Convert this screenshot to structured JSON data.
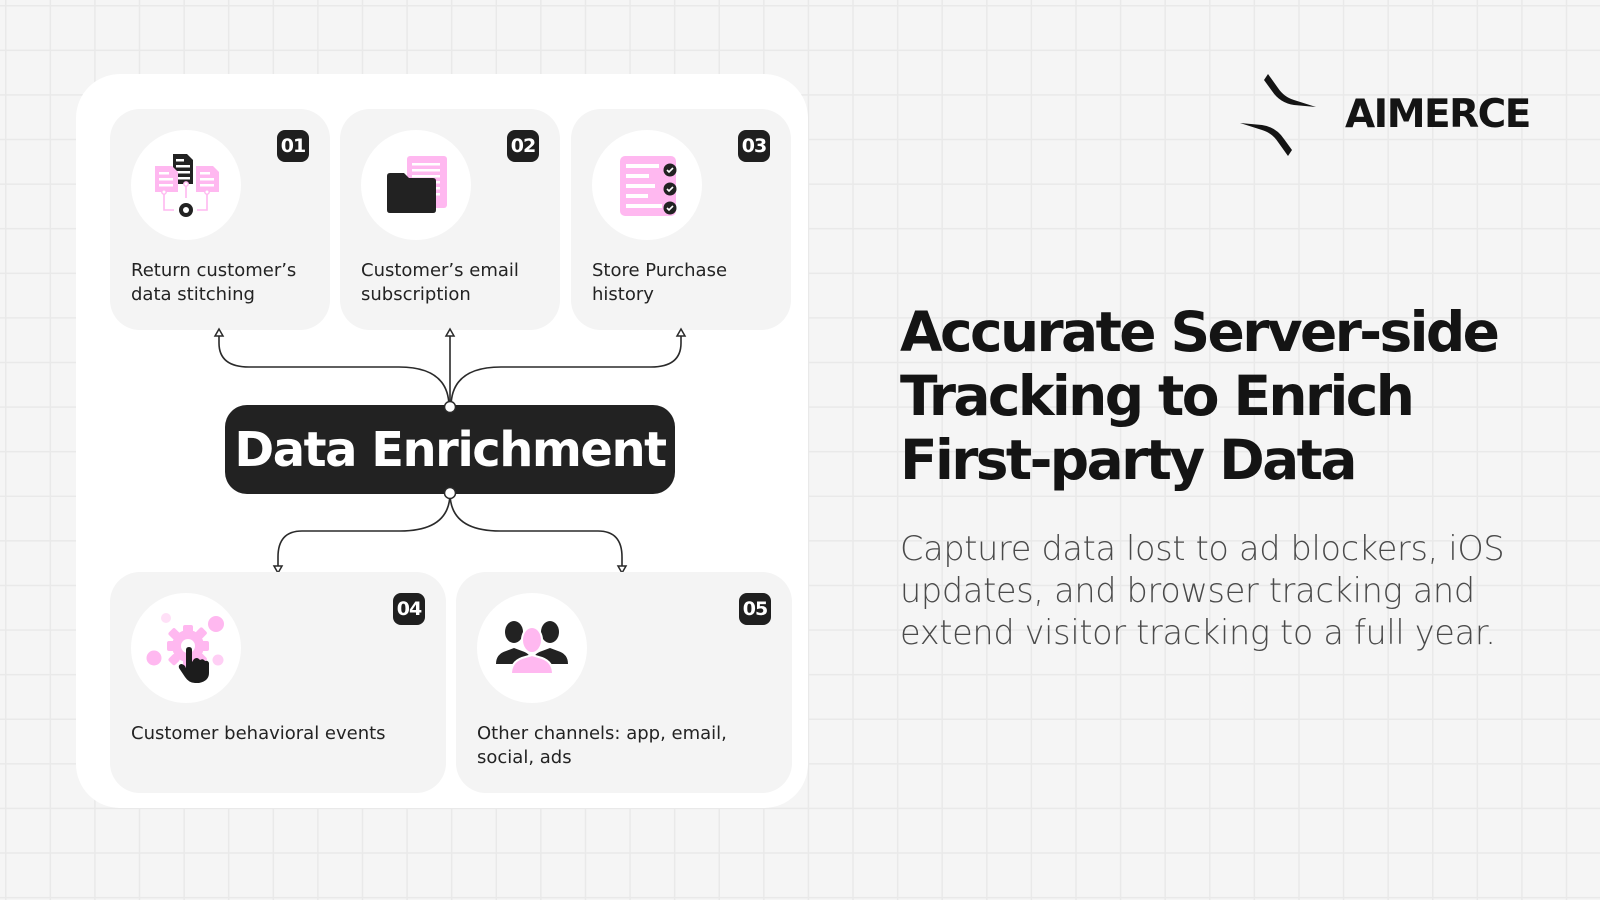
{
  "brand": {
    "name": "AIMERCE",
    "logo_icon": "aimerce-logo-icon"
  },
  "colors": {
    "accent_pink": "#ffb8f0",
    "dark": "#222222",
    "card_bg": "#f4f4f4",
    "panel_bg": "#ffffff",
    "page_bg": "#f5f5f5"
  },
  "diagram": {
    "hub_label": "Data Enrichment",
    "top_cards": [
      {
        "number": "01",
        "label": "Return customer’s data stitching",
        "icon": "data-stitching-icon"
      },
      {
        "number": "02",
        "label": "Customer’s email subscription",
        "icon": "email-folder-icon"
      },
      {
        "number": "03",
        "label": "Store Purchase history",
        "icon": "purchase-checklist-icon"
      }
    ],
    "bottom_cards": [
      {
        "number": "04",
        "label": "Customer behavioral events",
        "icon": "gear-click-icon"
      },
      {
        "number": "05",
        "label": "Other channels: app, email, social, ads",
        "icon": "users-group-icon"
      }
    ]
  },
  "headline": {
    "line1": "Accurate Server-side",
    "line2": "Tracking to Enrich",
    "line3": "First-party Data"
  },
  "subtext": "Capture data lost to ad blockers, iOS updates, and browser tracking and extend visitor tracking to a full year."
}
